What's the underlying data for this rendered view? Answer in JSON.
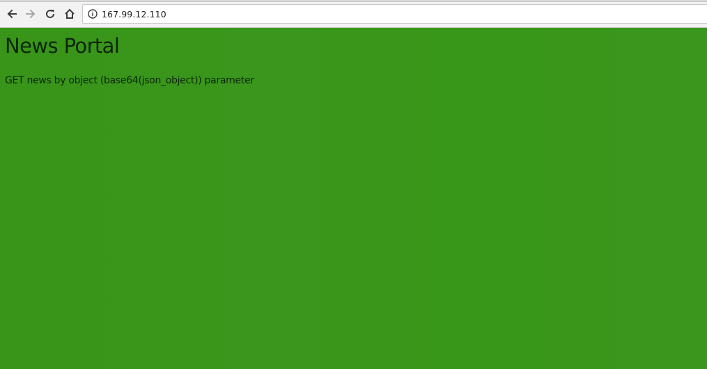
{
  "browser": {
    "address_bar": {
      "url": "167.99.12.110",
      "icon": "info-icon"
    },
    "nav_icons": [
      "back-arrow-icon",
      "forward-arrow-icon",
      "reload-icon",
      "home-icon"
    ]
  },
  "page": {
    "title": "News Portal",
    "description": "GET news by object (base64(json_object)) parameter",
    "background_color": "#3a961c",
    "text_color": "#0c260a"
  }
}
